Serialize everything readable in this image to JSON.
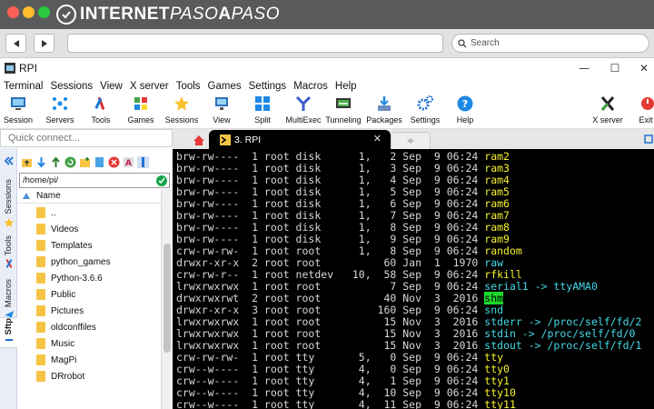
{
  "browser": {
    "brand": {
      "part1": "INTERNET",
      "part2": "PASO",
      "part3": "A",
      "part4": "PASO"
    },
    "search_placeholder": "Search",
    "traffic_colors": [
      "#ff5f57",
      "#ffbd2e",
      "#28c840"
    ]
  },
  "app": {
    "title": "RPI",
    "window_controls": [
      "—",
      "☐",
      "✕"
    ]
  },
  "menu": [
    "Terminal",
    "Sessions",
    "View",
    "X server",
    "Tools",
    "Games",
    "Settings",
    "Macros",
    "Help"
  ],
  "toolbar": {
    "items": [
      {
        "label": "Session",
        "icon": "session-icon"
      },
      {
        "label": "Servers",
        "icon": "servers-icon"
      },
      {
        "label": "Tools",
        "icon": "tools-icon"
      },
      {
        "label": "Games",
        "icon": "games-icon"
      },
      {
        "label": "Sessions",
        "icon": "sessions-star-icon"
      },
      {
        "label": "View",
        "icon": "view-icon"
      },
      {
        "label": "Split",
        "icon": "split-icon"
      },
      {
        "label": "MultiExec",
        "icon": "multiexec-icon"
      },
      {
        "label": "Tunneling",
        "icon": "tunneling-icon"
      },
      {
        "label": "Packages",
        "icon": "packages-icon"
      },
      {
        "label": "Settings",
        "icon": "settings-icon"
      },
      {
        "label": "Help",
        "icon": "help-icon"
      },
      {
        "label": "X server",
        "icon": "x-server-icon"
      },
      {
        "label": "Exit",
        "icon": "exit-icon"
      }
    ]
  },
  "left_panel": {
    "quick_connect_placeholder": "Quick connect...",
    "side_tabs": [
      "Sessions",
      "Tools",
      "Macros",
      "Sftp"
    ],
    "path": "/home/pi/",
    "column_header": "Name",
    "files": [
      "..",
      "Videos",
      "Templates",
      "python_games",
      "Python-3.6.6",
      "Public",
      "Pictures",
      "oldconffiles",
      "Music",
      "MagPi",
      "DRrobot"
    ]
  },
  "terminal_tab": {
    "label": "3. RPI",
    "close": "✕"
  },
  "terminal": {
    "lines": [
      {
        "text": "brw-rw----  1 root disk      1,   2 Sep  9 06:24 ",
        "name": "ram2",
        "color": "yellow"
      },
      {
        "text": "brw-rw----  1 root disk      1,   3 Sep  9 06:24 ",
        "name": "ram3",
        "color": "yellow"
      },
      {
        "text": "brw-rw----  1 root disk      1,   4 Sep  9 06:24 ",
        "name": "ram4",
        "color": "yellow"
      },
      {
        "text": "brw-rw----  1 root disk      1,   5 Sep  9 06:24 ",
        "name": "ram5",
        "color": "yellow"
      },
      {
        "text": "brw-rw----  1 root disk      1,   6 Sep  9 06:24 ",
        "name": "ram6",
        "color": "yellow"
      },
      {
        "text": "brw-rw----  1 root disk      1,   7 Sep  9 06:24 ",
        "name": "ram7",
        "color": "yellow"
      },
      {
        "text": "brw-rw----  1 root disk      1,   8 Sep  9 06:24 ",
        "name": "ram8",
        "color": "yellow"
      },
      {
        "text": "brw-rw----  1 root disk      1,   9 Sep  9 06:24 ",
        "name": "ram9",
        "color": "yellow"
      },
      {
        "text": "crw-rw-rw-  1 root root      1,   8 Sep  9 06:24 ",
        "name": "random",
        "color": "yellow"
      },
      {
        "text": "drwxr-xr-x  2 root root          60 Jan  1  1970 ",
        "name": "raw",
        "color": "cyan"
      },
      {
        "text": "crw-rw-r--  1 root netdev   10,  58 Sep  9 06:24 ",
        "name": "rfkill",
        "color": "yellow"
      },
      {
        "text": "lrwxrwxrwx  1 root root           7 Sep  9 06:24 ",
        "name": "serial1 -> ttyAMA0",
        "color": "cyan"
      },
      {
        "text": "drwxrwxrwt  2 root root          40 Nov  3  2016 ",
        "name": "shm",
        "color": "highlight"
      },
      {
        "text": "drwxr-xr-x  3 root root         160 Sep  9 06:24 ",
        "name": "snd",
        "color": "cyan"
      },
      {
        "text": "lrwxrwxrwx  1 root root          15 Nov  3  2016 ",
        "name": "stderr -> /proc/self/fd/2",
        "color": "cyan"
      },
      {
        "text": "lrwxrwxrwx  1 root root          15 Nov  3  2016 ",
        "name": "stdin -> /proc/self/fd/0",
        "color": "cyan"
      },
      {
        "text": "lrwxrwxrwx  1 root root          15 Nov  3  2016 ",
        "name": "stdout -> /proc/self/fd/1",
        "color": "cyan"
      },
      {
        "text": "crw-rw-rw-  1 root tty       5,   0 Sep  9 06:24 ",
        "name": "tty",
        "color": "yellow"
      },
      {
        "text": "crw--w----  1 root tty       4,   0 Sep  9 06:24 ",
        "name": "tty0",
        "color": "yellow"
      },
      {
        "text": "crw--w----  1 root tty       4,   1 Sep  9 06:24 ",
        "name": "tty1",
        "color": "yellow"
      },
      {
        "text": "crw--w----  1 root tty       4,  10 Sep  9 06:24 ",
        "name": "tty10",
        "color": "yellow"
      },
      {
        "text": "crw--w----  1 root tty       4,  11 Sep  9 06:24 ",
        "name": "tty11",
        "color": "yellow"
      }
    ]
  }
}
